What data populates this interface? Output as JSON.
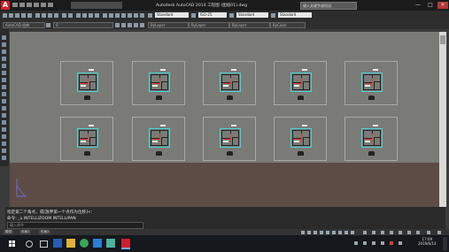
{
  "window": {
    "app_logo": "A",
    "title": "Autodesk AutoCAD 2014    工程图 (图纸01).dwg",
    "search_placeholder": "键入关键字或短语",
    "minimize": "—",
    "maximize": "□",
    "close": "✕"
  },
  "ribbon": {
    "text_style": "Standard",
    "dim_style": "ISO-25",
    "table_style": "Standard",
    "mleader_style": "Standard",
    "workspace": "AutoCAD 经典",
    "layer": "0",
    "color": "ByLayer",
    "linetype": "ByLayer",
    "lineweight": "ByLayer",
    "plot_style": "ByColor"
  },
  "drawing": {
    "sheets_rows": 2,
    "sheets_per_row": 5
  },
  "command": {
    "line1": "指定第二个角点，或[放弃第一个点作为位移]<:",
    "line2": "命令: _u INTELLIZOOM INTELLIPAN",
    "input_placeholder": "键入命令"
  },
  "layout_tabs": [
    "模型",
    "布局1",
    "布局2"
  ],
  "taskbar": {
    "clock_time": "17:09",
    "clock_date": "2019/6/14"
  },
  "colors": {
    "accent": "#c8232c",
    "canvas": "#7a7b76",
    "canvas_lower": "#5d4b45",
    "plan_cyan": "#4bd0d6",
    "plan_red": "#d64141"
  }
}
